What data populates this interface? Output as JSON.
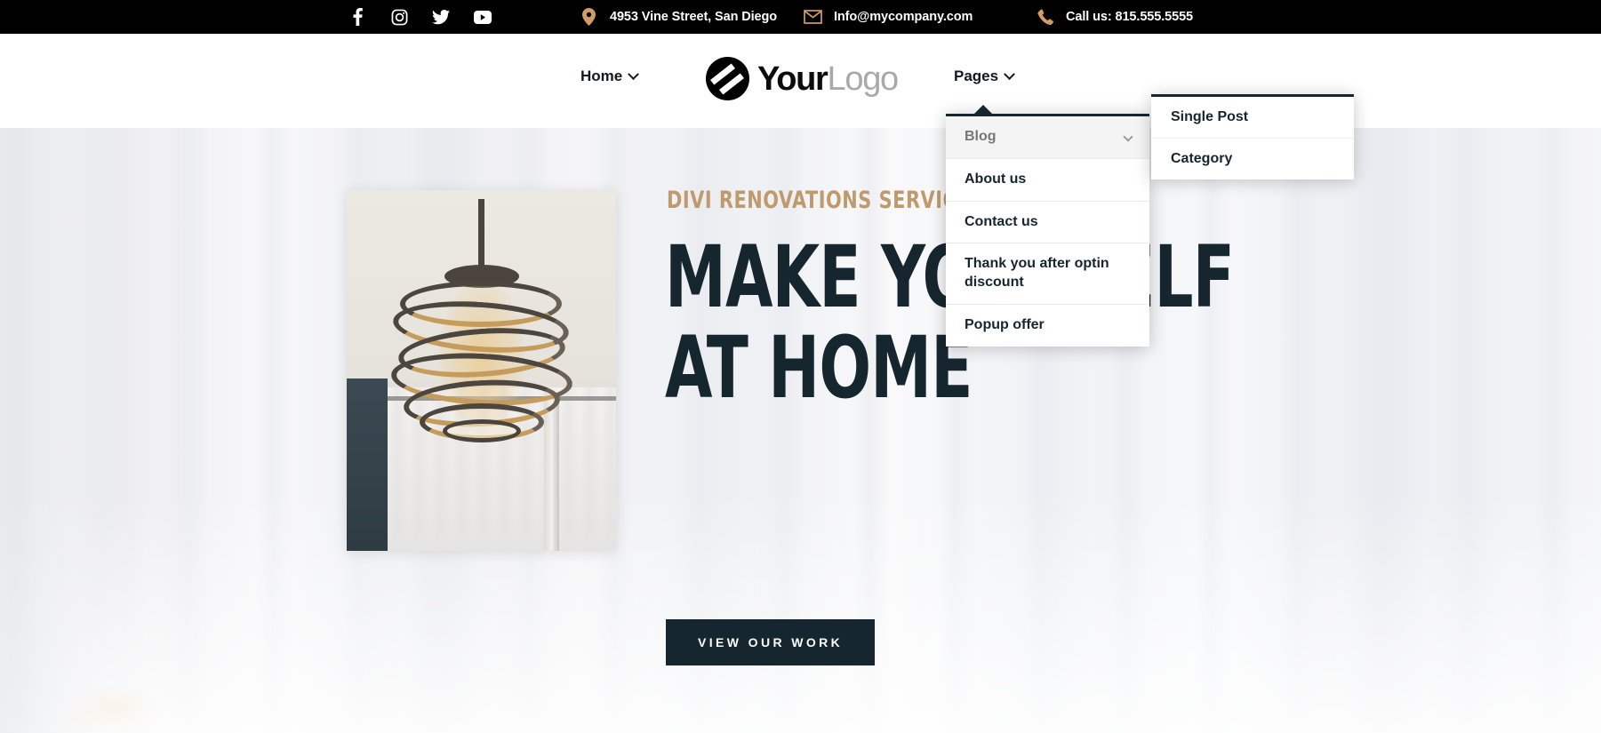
{
  "topbar": {
    "social": [
      {
        "name": "facebook-icon",
        "label": "Facebook"
      },
      {
        "name": "instagram-icon",
        "label": "Instagram"
      },
      {
        "name": "twitter-icon",
        "label": "Twitter"
      },
      {
        "name": "youtube-icon",
        "label": "YouTube"
      }
    ],
    "address": "4953 Vine Street, San Diego",
    "email": "Info@mycompany.com",
    "phone": "Call us: 815.555.5555",
    "background": "#000000",
    "icon_color": "#D29D63"
  },
  "header": {
    "nav": [
      {
        "label": "Home",
        "has_caret": true
      },
      {
        "label": "Pages",
        "has_caret": true
      }
    ],
    "logo": {
      "primary": "Your",
      "secondary": "Logo"
    }
  },
  "dropdown": {
    "items": [
      {
        "label": "Blog",
        "active": true,
        "has_submenu": true
      },
      {
        "label": "About us",
        "active": false,
        "has_submenu": false
      },
      {
        "label": "Contact us",
        "active": false,
        "has_submenu": false
      },
      {
        "label": "Thank you after optin discount",
        "active": false,
        "has_submenu": false
      },
      {
        "label": "Popup offer",
        "active": false,
        "has_submenu": false
      }
    ]
  },
  "submenu": {
    "items": [
      {
        "label": "Single Post"
      },
      {
        "label": "Category"
      }
    ]
  },
  "hero": {
    "eyebrow": "DIVI RENOVATIONS SERVICE",
    "title": "MAKE YOURSELF\nAT HOME",
    "button": "VIEW OUR WORK",
    "photo_alt": "chandelier-photo",
    "accent_color": "#bf9a6c",
    "title_color": "#16262f"
  }
}
